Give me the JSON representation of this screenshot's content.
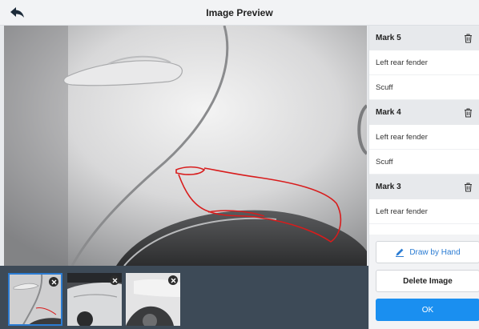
{
  "header": {
    "title": "Image Preview",
    "back_icon": "back-arrow-icon"
  },
  "marks": [
    {
      "title": "Mark 5",
      "location": "Left rear fender",
      "damage": "Scuff"
    },
    {
      "title": "Mark 4",
      "location": "Left rear fender",
      "damage": "Scuff"
    },
    {
      "title": "Mark 3",
      "location": "Left rear fender"
    }
  ],
  "actions": {
    "draw_label": "Draw by Hand",
    "delete_label": "Delete Image",
    "ok_label": "OK"
  },
  "thumbnails": {
    "count": 3,
    "selected_index": 0
  },
  "colors": {
    "accent": "#1a8ff0",
    "annotation": "#d81c1c",
    "strip": "#3d4a57"
  }
}
